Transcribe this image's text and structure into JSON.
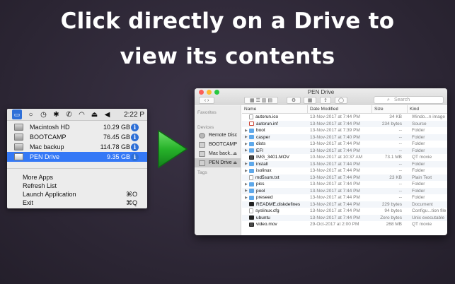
{
  "headline": {
    "line1": "Click directly on a Drive to",
    "line2": "view its contents"
  },
  "menubar": {
    "icons": [
      "drive-menu-icon",
      "circle-icon",
      "time-machine-icon",
      "bluetooth-icon",
      "phone-icon",
      "wifi-icon",
      "eject-icon",
      "volume-icon"
    ],
    "clock": "2:22 P"
  },
  "drives": [
    {
      "name": "Macintosh HD",
      "size": "10.29 GB",
      "ejectable": false,
      "selected": false
    },
    {
      "name": "BOOTCAMP",
      "size": "76.45 GB",
      "ejectable": false,
      "selected": false
    },
    {
      "name": "Mac backup",
      "size": "114.78 GB",
      "ejectable": true,
      "selected": false
    },
    {
      "name": "PEN Drive",
      "size": "9.35 GB",
      "ejectable": true,
      "selected": true
    }
  ],
  "menu_items": [
    {
      "label": "More Apps",
      "shortcut": ""
    },
    {
      "label": "Refresh List",
      "shortcut": ""
    },
    {
      "label": "Launch Application",
      "shortcut": "⌘O"
    },
    {
      "label": "Exit",
      "shortcut": "⌘Q"
    }
  ],
  "finder": {
    "title": "PEN Drive",
    "search_placeholder": "Search",
    "sidebar": {
      "favorites_header": "Favorites",
      "devices_header": "Devices",
      "tags_header": "Tags",
      "devices": [
        {
          "label": "Remote Disc",
          "selected": false,
          "eject": false
        },
        {
          "label": "BOOTCAMP",
          "selected": false,
          "eject": false
        },
        {
          "label": "Mac back...",
          "selected": false,
          "eject": true
        },
        {
          "label": "PEN Drive",
          "selected": true,
          "eject": true
        }
      ]
    },
    "columns": {
      "name": "Name",
      "date": "Date Modified",
      "size": "Size",
      "kind": "Kind"
    },
    "files": [
      {
        "name": "autorun.ico",
        "date": "13-Nov-2017 at 7:44 PM",
        "size": "34 KB",
        "kind": "Windo...n image",
        "icon": "file",
        "folder": false
      },
      {
        "name": "autorun.inf",
        "date": "13-Nov-2017 at 7:44 PM",
        "size": "234 bytes",
        "kind": "Source",
        "icon": "red",
        "folder": false
      },
      {
        "name": "boot",
        "date": "13-Nov-2017 at 7:39 PM",
        "size": "--",
        "kind": "Folder",
        "icon": "folder",
        "folder": true
      },
      {
        "name": "casper",
        "date": "13-Nov-2017 at 7:40 PM",
        "size": "--",
        "kind": "Folder",
        "icon": "folder",
        "folder": true
      },
      {
        "name": "dists",
        "date": "13-Nov-2017 at 7:44 PM",
        "size": "--",
        "kind": "Folder",
        "icon": "folder",
        "folder": true
      },
      {
        "name": "EFI",
        "date": "13-Nov-2017 at 7:44 PM",
        "size": "--",
        "kind": "Folder",
        "icon": "folder",
        "folder": true
      },
      {
        "name": "IMG_3401.MOV",
        "date": "10-Nov-2017 at 10:37 AM",
        "size": "73.1 MB",
        "kind": "QT movie",
        "icon": "movie",
        "folder": false
      },
      {
        "name": "install",
        "date": "13-Nov-2017 at 7:44 PM",
        "size": "--",
        "kind": "Folder",
        "icon": "folder",
        "folder": true
      },
      {
        "name": "isolinux",
        "date": "13-Nov-2017 at 7:44 PM",
        "size": "--",
        "kind": "Folder",
        "icon": "folder",
        "folder": true
      },
      {
        "name": "md5sum.txt",
        "date": "13-Nov-2017 at 7:44 PM",
        "size": "23 KB",
        "kind": "Plain Text",
        "icon": "file",
        "folder": false
      },
      {
        "name": "pics",
        "date": "13-Nov-2017 at 7:44 PM",
        "size": "--",
        "kind": "Folder",
        "icon": "folder",
        "folder": true
      },
      {
        "name": "pool",
        "date": "13-Nov-2017 at 7:44 PM",
        "size": "--",
        "kind": "Folder",
        "icon": "folder",
        "folder": true
      },
      {
        "name": "preseed",
        "date": "13-Nov-2017 at 7:44 PM",
        "size": "--",
        "kind": "Folder",
        "icon": "folder",
        "folder": true
      },
      {
        "name": "README.diskdefines",
        "date": "13-Nov-2017 at 7:44 PM",
        "size": "229 bytes",
        "kind": "Document",
        "icon": "dark",
        "folder": false
      },
      {
        "name": "syslinux.cfg",
        "date": "13-Nov-2017 at 7:44 PM",
        "size": "94 bytes",
        "kind": "Configu...tion file",
        "icon": "file",
        "folder": false
      },
      {
        "name": "ubuntu",
        "date": "13-Nov-2017 at 7:44 PM",
        "size": "Zero bytes",
        "kind": "Unix executable",
        "icon": "dark",
        "folder": false
      },
      {
        "name": "video.mov",
        "date": "29-Oct-2017 at 2:00 PM",
        "size": "268 MB",
        "kind": "QT movie",
        "icon": "movie",
        "folder": false
      }
    ]
  },
  "colors": {
    "accent": "#3478f6",
    "arrow": "#2db52d",
    "folder": "#5ea8ea",
    "background": "#2e2838"
  }
}
